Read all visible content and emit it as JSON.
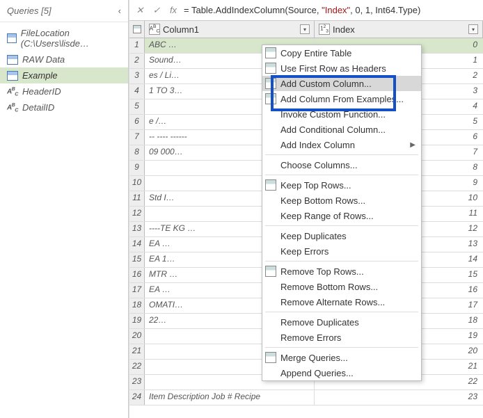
{
  "sidebar": {
    "title": "Queries [5]",
    "items": [
      {
        "label": "FileLocation (C:\\Users\\lisde…",
        "iconType": "table"
      },
      {
        "label": "RAW Data",
        "iconType": "table"
      },
      {
        "label": "Example",
        "iconType": "table",
        "selected": true
      },
      {
        "label": "HeaderID",
        "iconType": "abc"
      },
      {
        "label": "DetailID",
        "iconType": "abc"
      }
    ]
  },
  "formulaBar": {
    "prefix": "= Table.AddIndexColumn(Source, ",
    "string": "\"Index\"",
    "suffix": ", 0, 1, Int64.Type)"
  },
  "columns": {
    "col1": {
      "type": "ABC",
      "label": "Column1"
    },
    "col2": {
      "type": "123",
      "label": "Index"
    }
  },
  "rows": [
    {
      "n": 1,
      "c1": "ABC …",
      "c2": "0"
    },
    {
      "n": 2,
      "c1": "Sound…",
      "c2": "1"
    },
    {
      "n": 3,
      "c1": "es / Li…",
      "c2": "2"
    },
    {
      "n": 4,
      "c1": "1 TO 3…",
      "c2": "3"
    },
    {
      "n": 5,
      "c1": "",
      "c2": "4"
    },
    {
      "n": 6,
      "c1": "e    /…",
      "c2": "5"
    },
    {
      "n": 7,
      "c1": "-- ---- ------",
      "c2": "6"
    },
    {
      "n": 8,
      "c1": "09 000…",
      "c2": "7"
    },
    {
      "n": 9,
      "c1": "",
      "c2": "8"
    },
    {
      "n": 10,
      "c1": "",
      "c2": "9"
    },
    {
      "n": 11,
      "c1": "Std I…",
      "c2": "10"
    },
    {
      "n": 12,
      "c1": "",
      "c2": "11"
    },
    {
      "n": 13,
      "c1": "----TE KG …",
      "c2": "12"
    },
    {
      "n": 14,
      "c1": "EA   …",
      "c2": "13"
    },
    {
      "n": 15,
      "c1": "EA   1…",
      "c2": "14"
    },
    {
      "n": 16,
      "c1": "MTR  …",
      "c2": "15"
    },
    {
      "n": 17,
      "c1": "EA   …",
      "c2": "16"
    },
    {
      "n": 18,
      "c1": "OMATI…",
      "c2": "17"
    },
    {
      "n": 19,
      "c1": "22…",
      "c2": "18"
    },
    {
      "n": 20,
      "c1": "",
      "c2": "19"
    },
    {
      "n": 21,
      "c1": "",
      "c2": "20"
    },
    {
      "n": 22,
      "c1": "",
      "c2": "21"
    },
    {
      "n": 23,
      "c1": "",
      "c2": "22"
    },
    {
      "n": 24,
      "c1": "Item     Description       Job #  Recipe",
      "c2": "23"
    }
  ],
  "contextMenu": {
    "groups": [
      [
        {
          "label": "Copy Entire Table",
          "icon": true
        },
        {
          "label": "Use First Row as Headers",
          "icon": true
        },
        {
          "label": "Add Custom Column...",
          "icon": true,
          "highlighted": true
        },
        {
          "label": "Add Column From Examples...",
          "icon": true
        },
        {
          "label": "Invoke Custom Function..."
        },
        {
          "label": "Add Conditional Column..."
        },
        {
          "label": "Add Index Column",
          "submenu": true
        }
      ],
      [
        {
          "label": "Choose Columns..."
        }
      ],
      [
        {
          "label": "Keep Top Rows...",
          "icon": true
        },
        {
          "label": "Keep Bottom Rows..."
        },
        {
          "label": "Keep Range of Rows..."
        }
      ],
      [
        {
          "label": "Keep Duplicates"
        },
        {
          "label": "Keep Errors"
        }
      ],
      [
        {
          "label": "Remove Top Rows...",
          "icon": true
        },
        {
          "label": "Remove Bottom Rows..."
        },
        {
          "label": "Remove Alternate Rows..."
        }
      ],
      [
        {
          "label": "Remove Duplicates"
        },
        {
          "label": "Remove Errors"
        }
      ],
      [
        {
          "label": "Merge Queries...",
          "icon": true
        },
        {
          "label": "Append Queries..."
        }
      ]
    ]
  }
}
